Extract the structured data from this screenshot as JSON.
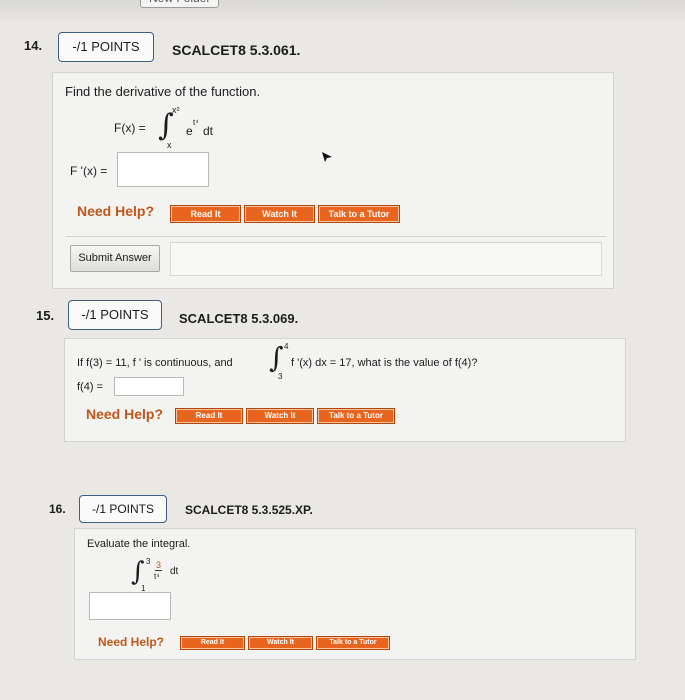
{
  "top": {
    "folder_button": "New Folder"
  },
  "q14": {
    "number": "14.",
    "points": "-/1 POINTS",
    "code": "SCALCET8 5.3.061.",
    "prompt": "Find the derivative of the function.",
    "function_lhs": "F(x) =",
    "upper": "x²",
    "lower": "x",
    "integrand": "e",
    "integrand_exp": "t⁴",
    "dt": "dt",
    "answer_label": "F '(x) =",
    "help": "Need Help?",
    "read": "Read It",
    "watch": "Watch It",
    "tutor": "Talk to a Tutor",
    "submit": "Submit Answer"
  },
  "q15": {
    "number": "15.",
    "points": "-/1 POINTS",
    "code": "SCALCET8 5.3.069.",
    "prompt_pre": "If f(3) = 11, f ' is continuous, and",
    "upper": "4",
    "lower": "3",
    "prompt_post": "f '(x) dx = 17,  what is the value of f(4)?",
    "answer_label": "f(4) =",
    "help": "Need Help?",
    "read": "Read It",
    "watch": "Watch It",
    "tutor": "Talk to a Tutor"
  },
  "q16": {
    "number": "16.",
    "points": "-/1 POINTS",
    "code": "SCALCET8 5.3.525.XP.",
    "prompt": "Evaluate the integral.",
    "upper": "3",
    "lower": "1",
    "numerator": "3",
    "denominator": "t⁴",
    "dt": "dt",
    "help": "Need Help?",
    "read": "Read It",
    "watch": "Watch It",
    "tutor": "Talk to a Tutor"
  }
}
